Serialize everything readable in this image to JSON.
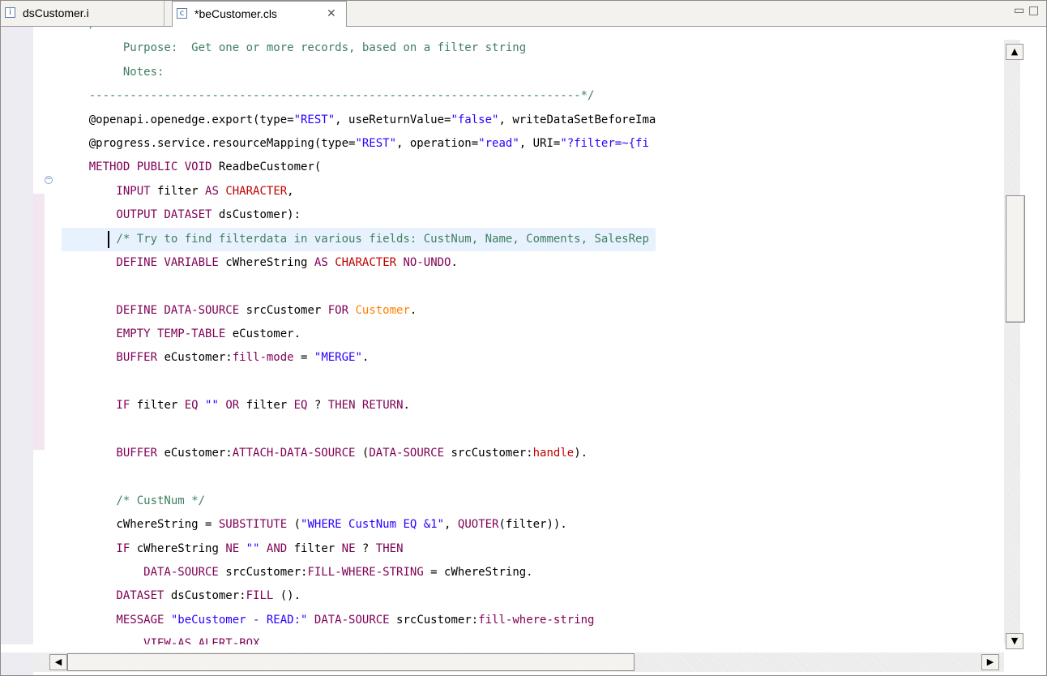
{
  "tabs": [
    {
      "label": "dsCustomer.i",
      "icon": "include-file-icon",
      "icon_glyph": "i"
    },
    {
      "label": "*beCustomer.cls",
      "icon": "class-file-icon",
      "icon_glyph": "c",
      "close_glyph": "✕"
    }
  ],
  "window_controls": {
    "minimize_glyph": "▭",
    "maximize_glyph": "□"
  },
  "scroll_glyphs": {
    "up": "▲",
    "down": "▼",
    "left": "◀",
    "right": "▶"
  },
  "fold_glyph": "−",
  "colors": {
    "keyword": "#7f0055",
    "type": "#c00000",
    "string": "#2a00ff",
    "comment": "#3f7f5f",
    "table": "#ff8000",
    "current_line": "#e8f2fe"
  },
  "code": {
    "lines": [
      [
        {
          "t": "com",
          "v": "    /"
        }
      ],
      [
        {
          "t": "com",
          "v": "         Purpose:  Get one or more records, based on a filter string"
        }
      ],
      [
        {
          "t": "com",
          "v": "         Notes:"
        }
      ],
      [
        {
          "t": "com",
          "v": "    ------------------------------------------------------------------------*/"
        }
      ],
      [
        {
          "t": "",
          "v": "    @openapi.openedge.export(type="
        },
        {
          "t": "str",
          "v": "\"REST\""
        },
        {
          "t": "",
          "v": ", useReturnValue="
        },
        {
          "t": "str",
          "v": "\"false\""
        },
        {
          "t": "",
          "v": ", writeDataSetBeforeIma"
        }
      ],
      [
        {
          "t": "",
          "v": "    @progress.service.resourceMapping(type="
        },
        {
          "t": "str",
          "v": "\"REST\""
        },
        {
          "t": "",
          "v": ", operation="
        },
        {
          "t": "str",
          "v": "\"read\""
        },
        {
          "t": "",
          "v": ", URI="
        },
        {
          "t": "str",
          "v": "\"?filter=~{fi"
        }
      ],
      [
        {
          "t": "kw",
          "v": "    METHOD PUBLIC VOID"
        },
        {
          "t": "",
          "v": " ReadbeCustomer("
        }
      ],
      [
        {
          "t": "kw",
          "v": "        INPUT"
        },
        {
          "t": "",
          "v": " filter "
        },
        {
          "t": "kw",
          "v": "AS"
        },
        {
          "t": "",
          "v": " "
        },
        {
          "t": "typ",
          "v": "CHARACTER"
        },
        {
          "t": "",
          "v": ","
        }
      ],
      [
        {
          "t": "kw",
          "v": "        OUTPUT DATASET"
        },
        {
          "t": "",
          "v": " dsCustomer):"
        }
      ],
      [
        {
          "t": "com",
          "v": "        /* Try to find filterdata in various fields: CustNum, Name, Comments, SalesRep"
        }
      ],
      [
        {
          "t": "kw",
          "v": "        DEFINE VARIABLE"
        },
        {
          "t": "",
          "v": " cWhereString "
        },
        {
          "t": "kw",
          "v": "AS"
        },
        {
          "t": "",
          "v": " "
        },
        {
          "t": "typ",
          "v": "CHARACTER"
        },
        {
          "t": "",
          "v": " "
        },
        {
          "t": "kw",
          "v": "NO-UNDO"
        },
        {
          "t": "",
          "v": "."
        }
      ],
      [
        {
          "t": "",
          "v": ""
        }
      ],
      [
        {
          "t": "kw",
          "v": "        DEFINE DATA-SOURCE"
        },
        {
          "t": "",
          "v": " srcCustomer "
        },
        {
          "t": "kw",
          "v": "FOR"
        },
        {
          "t": "",
          "v": " "
        },
        {
          "t": "tbl",
          "v": "Customer"
        },
        {
          "t": "",
          "v": "."
        }
      ],
      [
        {
          "t": "kw",
          "v": "        EMPTY TEMP-TABLE"
        },
        {
          "t": "",
          "v": " eCustomer."
        }
      ],
      [
        {
          "t": "kw",
          "v": "        BUFFER"
        },
        {
          "t": "",
          "v": " eCustomer:"
        },
        {
          "t": "kw",
          "v": "fill-mode"
        },
        {
          "t": "",
          "v": " = "
        },
        {
          "t": "str",
          "v": "\"MERGE\""
        },
        {
          "t": "",
          "v": "."
        }
      ],
      [
        {
          "t": "",
          "v": ""
        }
      ],
      [
        {
          "t": "kw",
          "v": "        IF"
        },
        {
          "t": "",
          "v": " filter "
        },
        {
          "t": "kw",
          "v": "EQ"
        },
        {
          "t": "",
          "v": " "
        },
        {
          "t": "str",
          "v": "\"\""
        },
        {
          "t": "",
          "v": " "
        },
        {
          "t": "kw",
          "v": "OR"
        },
        {
          "t": "",
          "v": " filter "
        },
        {
          "t": "kw",
          "v": "EQ"
        },
        {
          "t": "",
          "v": " ? "
        },
        {
          "t": "kw",
          "v": "THEN RETURN"
        },
        {
          "t": "",
          "v": "."
        }
      ],
      [
        {
          "t": "",
          "v": ""
        }
      ],
      [
        {
          "t": "kw",
          "v": "        BUFFER"
        },
        {
          "t": "",
          "v": " eCustomer:"
        },
        {
          "t": "kw",
          "v": "ATTACH-DATA-SOURCE"
        },
        {
          "t": "",
          "v": " ("
        },
        {
          "t": "kw",
          "v": "DATA-SOURCE"
        },
        {
          "t": "",
          "v": " srcCustomer:"
        },
        {
          "t": "typ",
          "v": "handle"
        },
        {
          "t": "",
          "v": ")."
        }
      ],
      [
        {
          "t": "",
          "v": ""
        }
      ],
      [
        {
          "t": "com",
          "v": "        /* CustNum */"
        }
      ],
      [
        {
          "t": "",
          "v": "        cWhereString = "
        },
        {
          "t": "kw",
          "v": "SUBSTITUTE"
        },
        {
          "t": "",
          "v": " ("
        },
        {
          "t": "str",
          "v": "\"WHERE CustNum EQ &1\""
        },
        {
          "t": "",
          "v": ", "
        },
        {
          "t": "kw",
          "v": "QUOTER"
        },
        {
          "t": "",
          "v": "(filter))."
        }
      ],
      [
        {
          "t": "kw",
          "v": "        IF"
        },
        {
          "t": "",
          "v": " cWhereString "
        },
        {
          "t": "kw",
          "v": "NE"
        },
        {
          "t": "",
          "v": " "
        },
        {
          "t": "str",
          "v": "\"\""
        },
        {
          "t": "",
          "v": " "
        },
        {
          "t": "kw",
          "v": "AND"
        },
        {
          "t": "",
          "v": " filter "
        },
        {
          "t": "kw",
          "v": "NE"
        },
        {
          "t": "",
          "v": " ? "
        },
        {
          "t": "kw",
          "v": "THEN"
        }
      ],
      [
        {
          "t": "kw",
          "v": "            DATA-SOURCE"
        },
        {
          "t": "",
          "v": " srcCustomer:"
        },
        {
          "t": "kw",
          "v": "FILL-WHERE-STRING"
        },
        {
          "t": "",
          "v": " = cWhereString."
        }
      ],
      [
        {
          "t": "kw",
          "v": "        DATASET"
        },
        {
          "t": "",
          "v": " dsCustomer:"
        },
        {
          "t": "kw",
          "v": "FILL"
        },
        {
          "t": "",
          "v": " ()."
        }
      ],
      [
        {
          "t": "kw",
          "v": "        MESSAGE"
        },
        {
          "t": "",
          "v": " "
        },
        {
          "t": "str",
          "v": "\"beCustomer - READ:\""
        },
        {
          "t": "",
          "v": " "
        },
        {
          "t": "kw",
          "v": "DATA-SOURCE"
        },
        {
          "t": "",
          "v": " srcCustomer:"
        },
        {
          "t": "kw",
          "v": "fill-where-string"
        }
      ],
      [
        {
          "t": "kw",
          "v": "            VIEW-AS ALERT-BOX"
        },
        {
          "t": "",
          "v": "."
        }
      ]
    ],
    "current_line_index": 9
  }
}
